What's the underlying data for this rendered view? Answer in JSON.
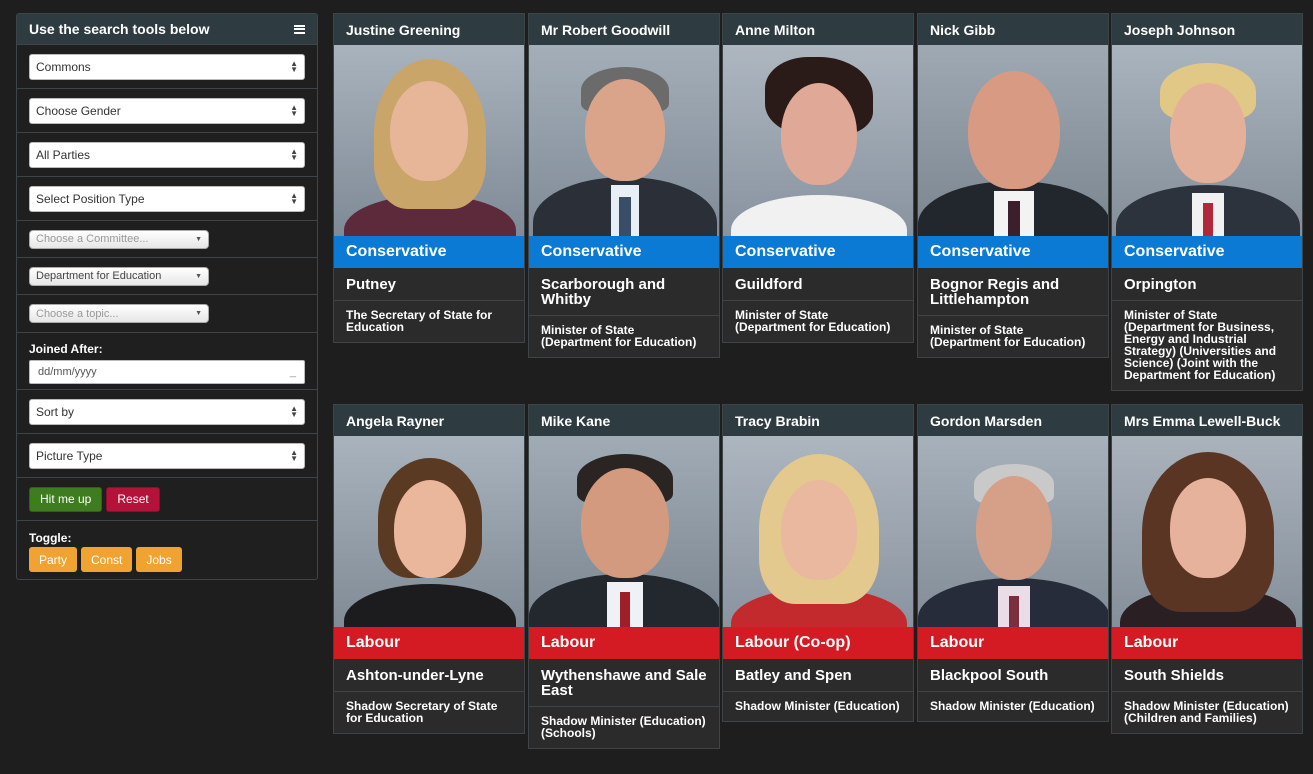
{
  "sidebar": {
    "title": "Use the search tools below",
    "selects": {
      "house": "Commons",
      "gender": "Choose Gender",
      "party": "All Parties",
      "position_type": "Select Position Type",
      "committee": "Choose a Committee...",
      "department": "Department for Education",
      "topic": "Choose a topic...",
      "sort": "Sort by",
      "picture_type": "Picture Type"
    },
    "joined_label": "Joined After:",
    "date_placeholder": "dd/mm/yyyy",
    "go_label": "Hit me up",
    "reset_label": "Reset",
    "toggle_label": "Toggle:",
    "toggles": [
      "Party",
      "Const",
      "Jobs"
    ]
  },
  "colors": {
    "conservative": "#0a7ad5",
    "labour": "#d41b24",
    "go": "#3e7d1f",
    "reset": "#b5123a",
    "toggle": "#f0a330"
  },
  "members": [
    {
      "name": "Justine Greening",
      "party": "Conservative",
      "constituency": "Putney",
      "job": "The Secretary of State for Education"
    },
    {
      "name": "Mr Robert Goodwill",
      "party": "Conservative",
      "constituency": "Scarborough and Whitby",
      "job": "Minister of State (Department for Education)"
    },
    {
      "name": "Anne Milton",
      "party": "Conservative",
      "constituency": "Guildford",
      "job": "Minister of State (Department for Education)"
    },
    {
      "name": "Nick Gibb",
      "party": "Conservative",
      "constituency": "Bognor Regis and Littlehampton",
      "job": "Minister of State (Department for Education)"
    },
    {
      "name": "Joseph Johnson",
      "party": "Conservative",
      "constituency": "Orpington",
      "job": "Minister of State (Department for Business, Energy and Industrial Strategy) (Universities and Science) (Joint with the Department for Education)"
    },
    {
      "name": "Angela Rayner",
      "party": "Labour",
      "constituency": "Ashton-under-Lyne",
      "job": "Shadow Secretary of State for Education"
    },
    {
      "name": "Mike Kane",
      "party": "Labour",
      "constituency": "Wythenshawe and Sale East",
      "job": "Shadow Minister (Education) (Schools)"
    },
    {
      "name": "Tracy Brabin",
      "party": "Labour (Co-op)",
      "constituency": "Batley and Spen",
      "job": "Shadow Minister (Education)"
    },
    {
      "name": "Gordon Marsden",
      "party": "Labour",
      "constituency": "Blackpool South",
      "job": "Shadow Minister (Education)"
    },
    {
      "name": "Mrs Emma Lewell-Buck",
      "party": "Labour",
      "constituency": "South Shields",
      "job": "Shadow Minister (Education) (Children and Families)"
    }
  ]
}
